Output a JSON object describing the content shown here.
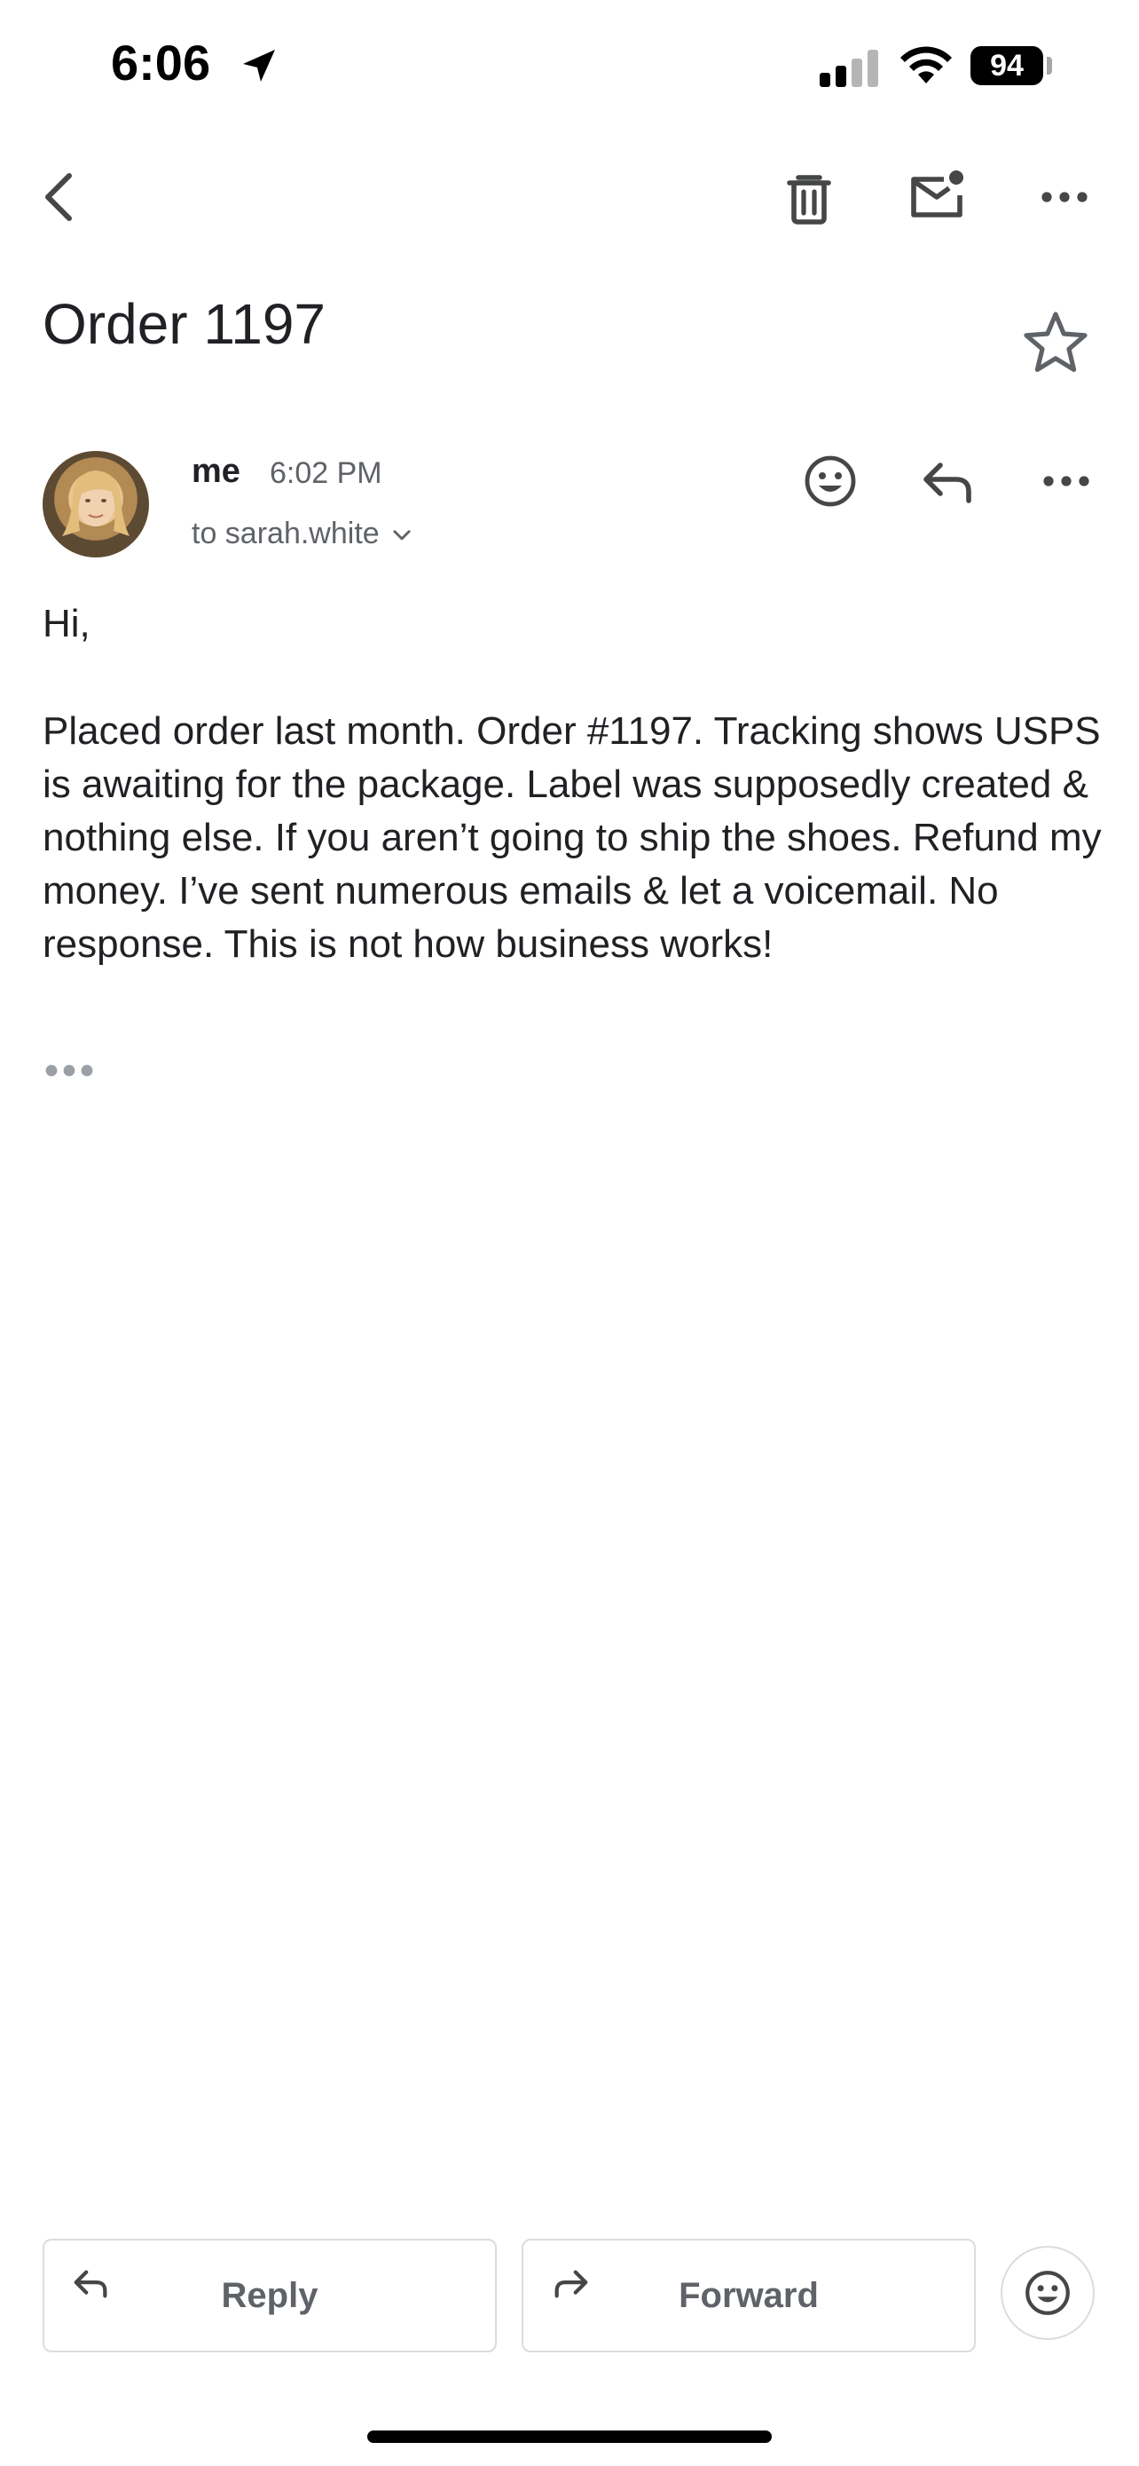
{
  "status_bar": {
    "time": "6:06",
    "battery": "94"
  },
  "toolbar": {
    "back_icon": "chevron-left-icon",
    "delete_icon": "trash-icon",
    "mark_unread_icon": "mail-unread-icon",
    "more_icon": "more-horizontal-icon"
  },
  "email": {
    "subject": "Order 1197",
    "sender": "me",
    "time": "6:02 PM",
    "recipient": "to sarah.white",
    "greeting": "Hi,",
    "body": "Placed order last month. Order #1197. Tracking shows USPS is awaiting for the package. Label was supposedly created & nothing else. If you aren’t going to ship the shoes. Refund my money. I’ve sent numerous emails & let a voicemail. No response. This is not how business works!"
  },
  "actions": {
    "reply_label": "Reply",
    "forward_label": "Forward"
  },
  "colors": {
    "text_primary": "#202124",
    "text_secondary": "#5f6368",
    "border": "#dadce0",
    "icon": "#444746"
  }
}
